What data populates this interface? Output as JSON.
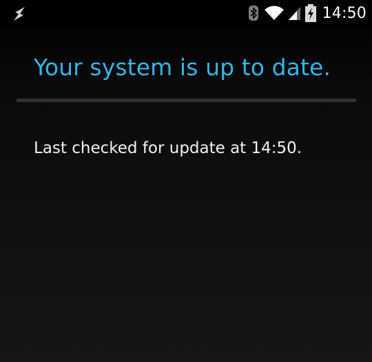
{
  "status_bar": {
    "time": "14:50",
    "icons": {
      "left": "usb-debug-icon",
      "bluetooth": "bluetooth-icon",
      "wifi": "wifi-icon",
      "signal": "cell-signal-icon",
      "battery": "battery-charging-icon"
    }
  },
  "update": {
    "title": "Your system is up to date.",
    "message": "Last checked for update at 14:50."
  },
  "colors": {
    "accent": "#33b5e5",
    "divider": "#303234",
    "background": "#000000"
  }
}
